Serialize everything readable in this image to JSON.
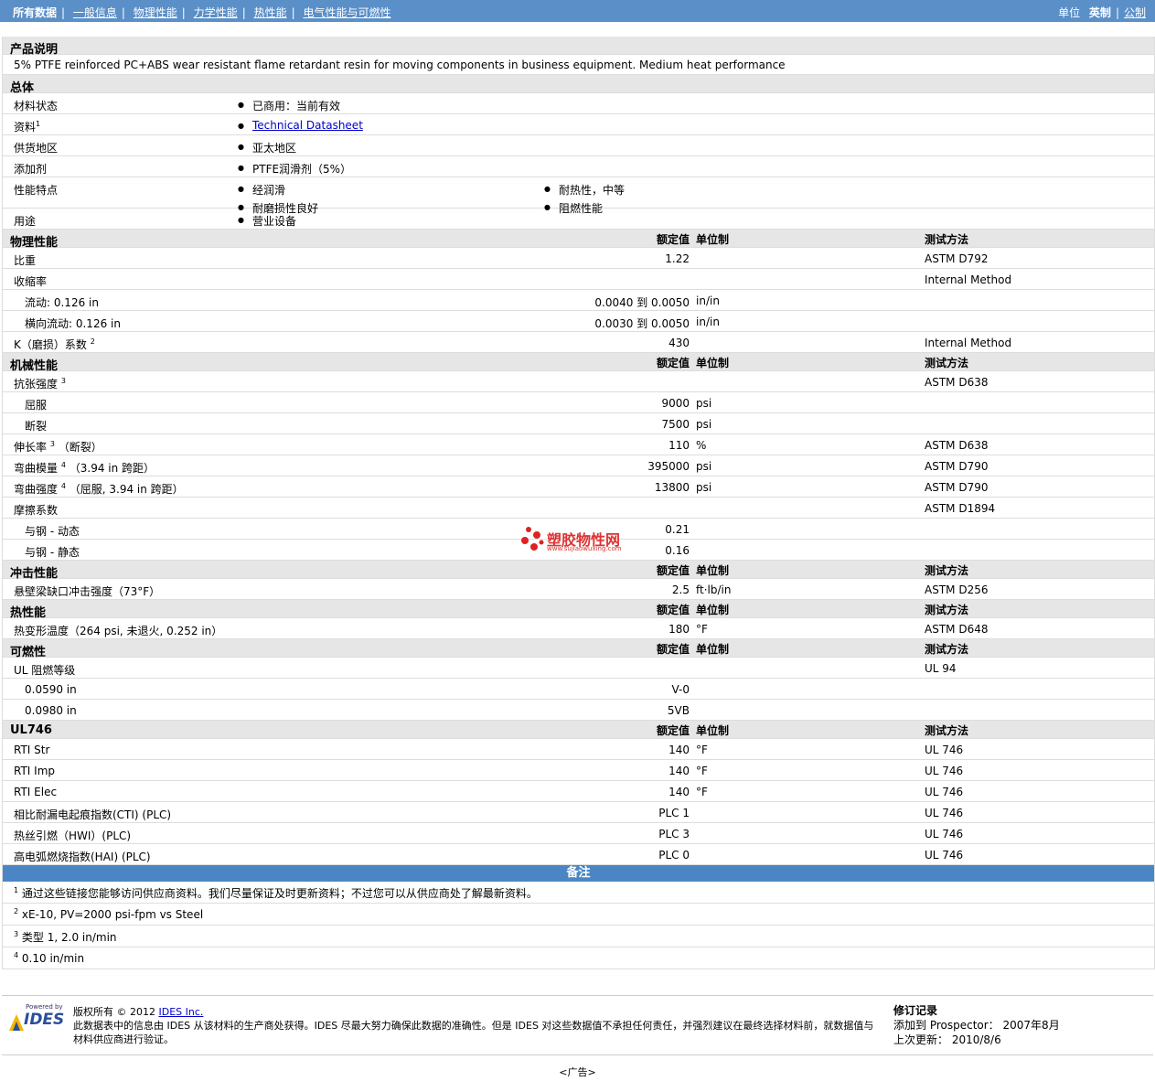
{
  "nav": {
    "items": [
      "所有数据",
      "一般信息",
      "物理性能",
      "力学性能",
      "热性能",
      "电气性能与可燃性"
    ],
    "units_label": "单位",
    "unit_english": "英制",
    "unit_metric": "公制"
  },
  "desc_title": "产品说明",
  "description": "5% PTFE reinforced PC+ABS wear resistant flame retardant resin for moving components in business equipment. Medium heat performance",
  "general": {
    "title": "总体",
    "rows": [
      {
        "label": "材料状态",
        "items": [
          "已商用：当前有效"
        ]
      },
      {
        "label": "资料",
        "sup": "1",
        "items": [
          "Technical Datasheet"
        ],
        "link": true
      },
      {
        "label": "供货地区",
        "items": [
          "亚太地区"
        ]
      },
      {
        "label": "添加剂",
        "items": [
          "PTFE润滑剂（5%）"
        ]
      },
      {
        "label": "性能特点",
        "items": [
          "经润滑",
          "耐热性，中等",
          "耐磨损性良好",
          "阻燃性能"
        ],
        "tall": true
      },
      {
        "label": "用途",
        "items": [
          "营业设备"
        ]
      }
    ]
  },
  "headers": {
    "value": "额定值",
    "unit": "单位制",
    "method": "测试方法"
  },
  "sections": [
    {
      "title": "物理性能",
      "rows": [
        {
          "label": "比重",
          "value": "1.22",
          "unit": "",
          "method": "ASTM D792"
        },
        {
          "label": "收缩率",
          "value": "",
          "unit": "",
          "method": "Internal Method"
        },
        {
          "label": "流动: 0.126 in",
          "value": "0.0040 到  0.0050",
          "unit": "in/in",
          "method": "",
          "sub": true
        },
        {
          "label": "横向流动: 0.126 in",
          "value": "0.0030 到  0.0050",
          "unit": "in/in",
          "method": "",
          "sub": true
        },
        {
          "label": "K（磨损）系数",
          "sup": "2",
          "value": "430",
          "unit": "",
          "method": "Internal Method"
        }
      ]
    },
    {
      "title": "机械性能",
      "rows": [
        {
          "label": "抗张强度",
          "sup": "3",
          "value": "",
          "unit": "",
          "method": "ASTM D638"
        },
        {
          "label": "屈服",
          "value": "9000",
          "unit": "psi",
          "method": "",
          "sub": true
        },
        {
          "label": "断裂",
          "value": "7500",
          "unit": "psi",
          "method": "",
          "sub": true
        },
        {
          "label": "伸长率",
          "sup": "3",
          "suffix": "（断裂）",
          "value": "110",
          "unit": "%",
          "method": "ASTM D638"
        },
        {
          "label": "弯曲模量",
          "sup": "4",
          "suffix": "（3.94 in 跨距）",
          "value": "395000",
          "unit": "psi",
          "method": "ASTM D790"
        },
        {
          "label": "弯曲强度",
          "sup": "4",
          "suffix": "（屈服, 3.94 in 跨距）",
          "value": "13800",
          "unit": "psi",
          "method": "ASTM D790"
        },
        {
          "label": "摩擦系数",
          "value": "",
          "unit": "",
          "method": "ASTM D1894"
        },
        {
          "label": "与钢 - 动态",
          "value": "0.21",
          "unit": "",
          "method": "",
          "sub": true
        },
        {
          "label": "与钢 - 静态",
          "value": "0.16",
          "unit": "",
          "method": "",
          "sub": true
        }
      ]
    },
    {
      "title": "冲击性能",
      "rows": [
        {
          "label": "悬壁梁缺口冲击强度（73°F）",
          "value": "2.5",
          "unit": "ft·lb/in",
          "method": "ASTM D256"
        }
      ]
    },
    {
      "title": "热性能",
      "rows": [
        {
          "label": "热变形温度（264 psi, 未退火, 0.252 in）",
          "value": "180",
          "unit": "°F",
          "method": "ASTM D648"
        }
      ]
    },
    {
      "title": "可燃性",
      "rows": [
        {
          "label": "UL 阻燃等级",
          "value": "",
          "unit": "",
          "method": "UL 94"
        },
        {
          "label": "0.0590 in",
          "value": "V-0",
          "unit": "",
          "method": "",
          "sub": true
        },
        {
          "label": "0.0980 in",
          "value": "5VB",
          "unit": "",
          "method": "",
          "sub": true
        }
      ]
    },
    {
      "title": "UL746",
      "rows": [
        {
          "label": "RTI Str",
          "value": "140",
          "unit": "°F",
          "method": "UL 746"
        },
        {
          "label": "RTI Imp",
          "value": "140",
          "unit": "°F",
          "method": "UL 746"
        },
        {
          "label": "RTI Elec",
          "value": "140",
          "unit": "°F",
          "method": "UL 746"
        },
        {
          "label": "相比耐漏电起痕指数(CTI) (PLC)",
          "value": "PLC 1",
          "unit": "",
          "method": "UL 746"
        },
        {
          "label": "热丝引燃（HWI）(PLC)",
          "value": "PLC 3",
          "unit": "",
          "method": "UL 746"
        },
        {
          "label": "高电弧燃烧指数(HAI) (PLC)",
          "value": "PLC 0",
          "unit": "",
          "method": "UL 746"
        }
      ]
    }
  ],
  "notes_title": "备注",
  "notes": [
    {
      "n": "1",
      "text": "通过这些链接您能够访问供应商资料。我们尽量保证及时更新资料；不过您可以从供应商处了解最新资料。"
    },
    {
      "n": "2",
      "text": "xE-10, PV=2000 psi-fpm vs Steel"
    },
    {
      "n": "3",
      "text": "类型  1, 2.0 in/min"
    },
    {
      "n": "4",
      "text": "0.10 in/min"
    }
  ],
  "watermark": {
    "name": "塑胶物性网",
    "url": "www.sujiaowuxing.com"
  },
  "footer": {
    "logo_small": "Powered by",
    "logo_big": "IDES",
    "copyright": "版权所有 © 2012",
    "company": "IDES Inc.",
    "disclaimer": "此数据表中的信息由 IDES 从该材料的生产商处获得。IDES 尽最大努力确保此数据的准确性。但是 IDES 对这些数据值不承担任何责任，并强烈建议在最终选择材料前，就数据值与材料供应商进行验证。",
    "rev_title": "修订记录",
    "rev_added_label": "添加到 Prospector：",
    "rev_added": "2007年8月",
    "rev_updated_label": "上次更新：",
    "rev_updated": "2010/8/6"
  },
  "ad": "<广告>"
}
